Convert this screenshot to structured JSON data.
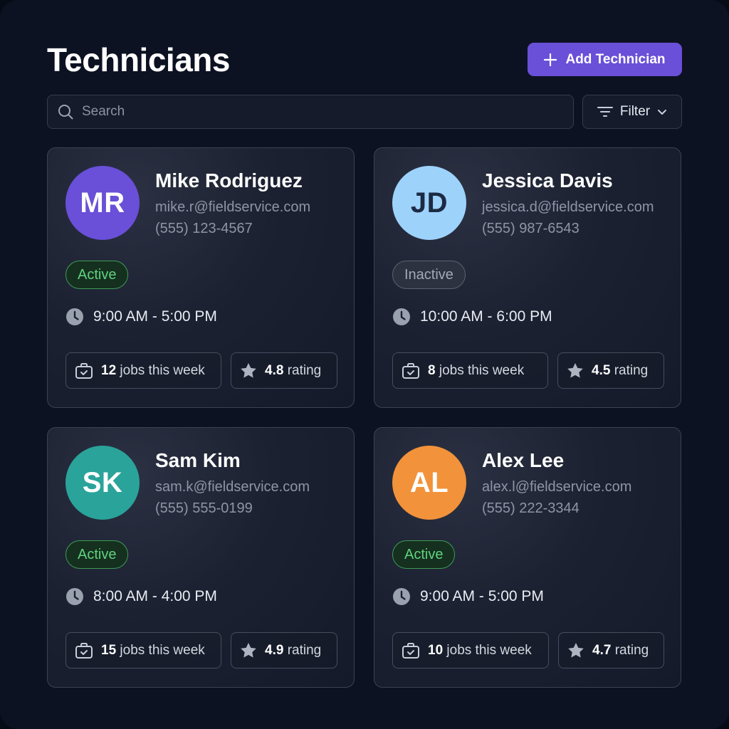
{
  "header": {
    "title": "Technicians",
    "add_button_label": "Add Technician"
  },
  "toolbar": {
    "search_placeholder": "Search",
    "filter_label": "Filter"
  },
  "colors": {
    "accent": "#6a4fd8",
    "active": "#5fd37f",
    "inactive": "#a2a9b6"
  },
  "technicians": [
    {
      "initials": "MR",
      "name": "Mike Rodriguez",
      "email": "mike.r@fieldservice.com",
      "phone": "(555) 123-4567",
      "status": "Active",
      "hours": "9:00 AM - 5:00 PM",
      "jobs_count": "12",
      "jobs_label": "jobs this week",
      "rating": "4.8",
      "rating_label": "rating",
      "avatar_color": "#6a4fd8",
      "avatar_text_color": "#ffffff"
    },
    {
      "initials": "JD",
      "name": "Jessica Davis",
      "email": "jessica.d@fieldservice.com",
      "phone": "(555) 987-6543",
      "status": "Inactive",
      "hours": "10:00 AM - 6:00 PM",
      "jobs_count": "8",
      "jobs_label": "jobs this week",
      "rating": "4.5",
      "rating_label": "rating",
      "avatar_color": "#9dd2fb",
      "avatar_text_color": "#1c2a44"
    },
    {
      "initials": "SK",
      "name": "Sam Kim",
      "email": "sam.k@fieldservice.com",
      "phone": "(555) 555-0199",
      "status": "Active",
      "hours": "8:00 AM - 4:00 PM",
      "jobs_count": "15",
      "jobs_label": "jobs this week",
      "rating": "4.9",
      "rating_label": "rating",
      "avatar_color": "#2aa39a",
      "avatar_text_color": "#ffffff"
    },
    {
      "initials": "AL",
      "name": "Alex Lee",
      "email": "alex.l@fieldservice.com",
      "phone": "(555) 222-3344",
      "status": "Active",
      "hours": "9:00 AM - 5:00 PM",
      "jobs_count": "10",
      "jobs_label": "jobs this week",
      "rating": "4.7",
      "rating_label": "rating",
      "avatar_color": "#f2923a",
      "avatar_text_color": "#ffffff"
    }
  ]
}
